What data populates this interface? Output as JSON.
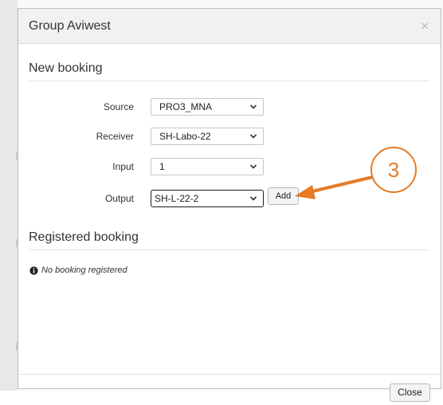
{
  "modal": {
    "title": "Group Aviwest",
    "close_icon": "close-icon"
  },
  "new_booking": {
    "heading": "New booking",
    "fields": [
      {
        "label": "Source",
        "value": "PRO3_MNA"
      },
      {
        "label": "Receiver",
        "value": "SH-Labo-22"
      },
      {
        "label": "Input",
        "value": "1"
      },
      {
        "label": "Output",
        "value": "SH-L-22-2"
      }
    ],
    "add_label": "Add"
  },
  "registered_booking": {
    "heading": "Registered booking",
    "empty_message": "No booking registered",
    "empty_icon": "info-circle-icon"
  },
  "footer": {
    "close_label": "Close"
  },
  "annotation": {
    "step": "3",
    "color": "#e57b26"
  }
}
